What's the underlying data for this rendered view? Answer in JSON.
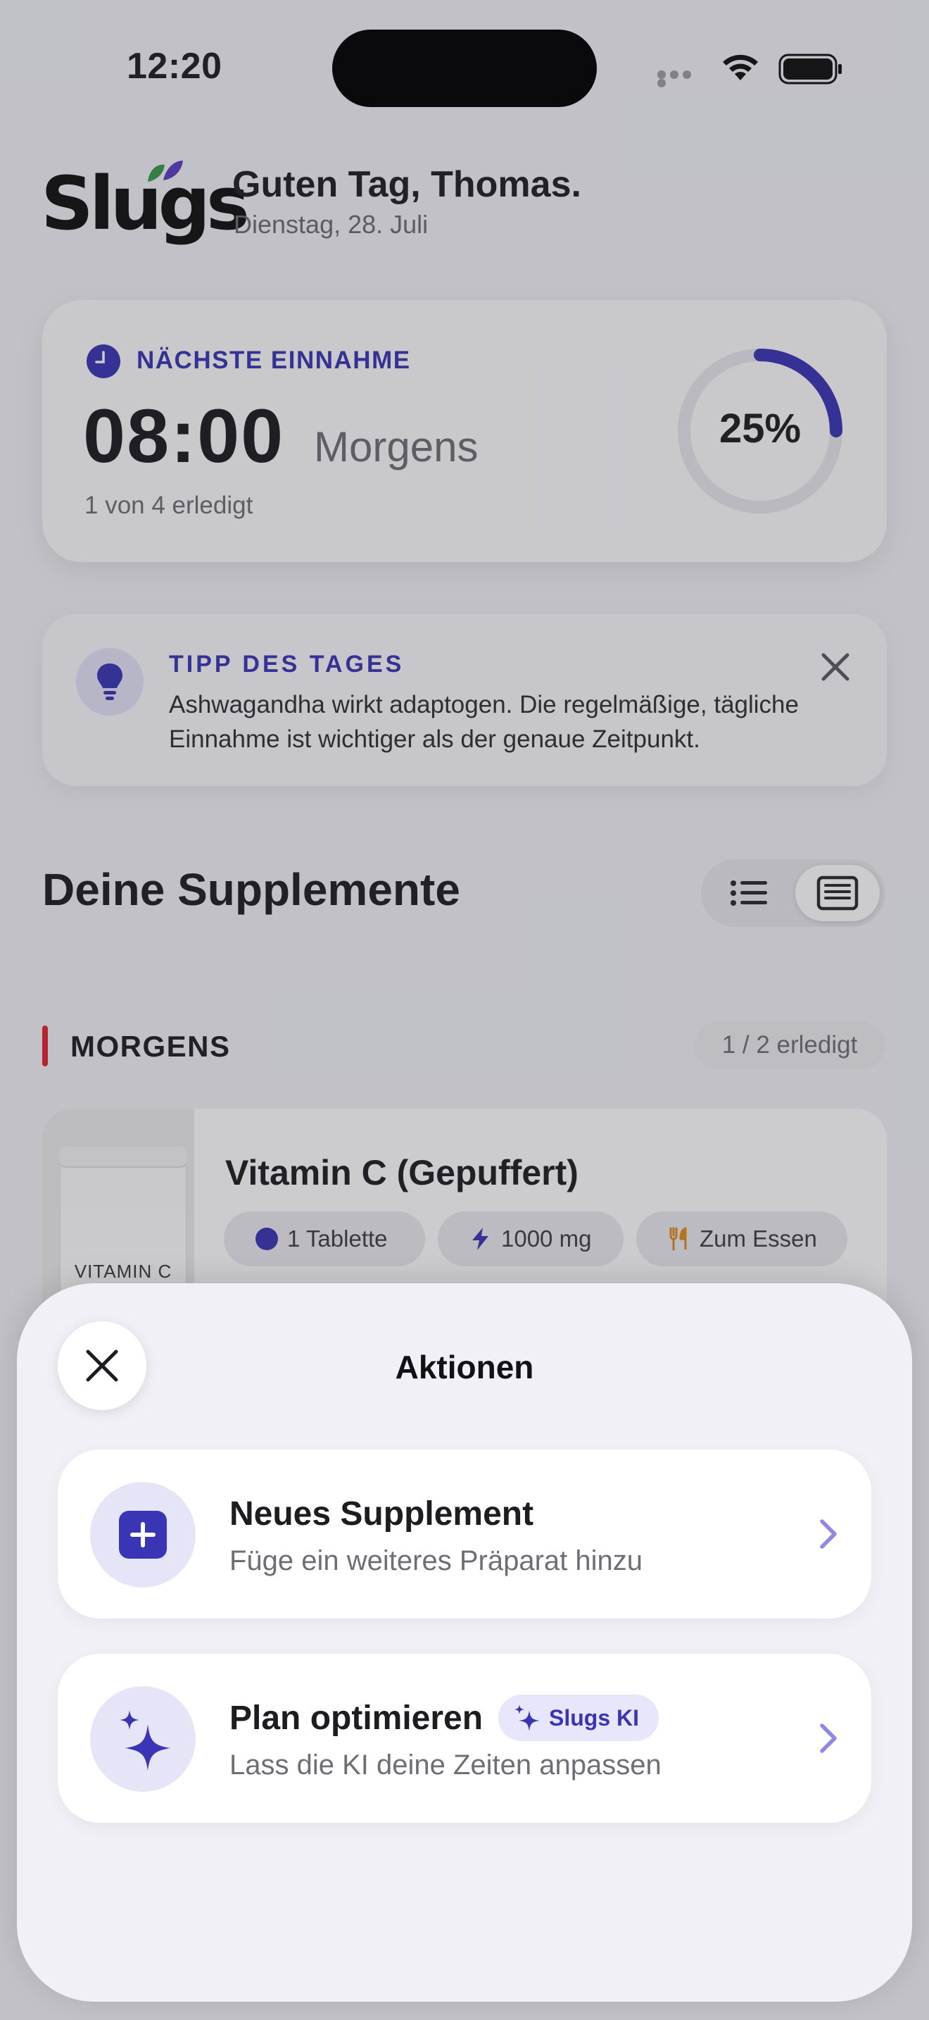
{
  "status": {
    "time": "12:20"
  },
  "header": {
    "logo": "Slugs",
    "greeting": "Guten Tag, Thomas.",
    "date": "Dienstag, 28. Juli"
  },
  "next_intake": {
    "label": "NÄCHSTE EINNAHME",
    "time": "08:00",
    "slot": "Morgens",
    "done_text": "1 von 4 erledigt",
    "progress_text": "25%",
    "progress": 0.25
  },
  "tip": {
    "title": "TIPP DES TAGES",
    "text": "Ashwagandha wirkt adaptogen. Die regelmäßige, tägliche Einnahme ist wichtiger als der genaue Zeitpunkt."
  },
  "supplements": {
    "title": "Deine Supplemente",
    "slot": {
      "title": "MORGENS",
      "count": "1 / 2 erledigt",
      "color": "#e0242c"
    },
    "item": {
      "name": "Vitamin C (Gepuffert)",
      "image_label": "VITAMIN C",
      "chips": [
        "1 Tablette",
        "1000 mg",
        "Zum Essen"
      ]
    }
  },
  "sheet": {
    "title": "Aktionen",
    "actions": [
      {
        "title": "Neues Supplement",
        "subtitle": "Füge ein weiteres Präparat hinzu",
        "icon": "plus-icon"
      },
      {
        "title": "Plan optimieren",
        "badge": "Slugs KI",
        "subtitle": "Lass die KI deine Zeiten anpassen",
        "icon": "sparkles-icon"
      }
    ]
  },
  "colors": {
    "accent": "#3a35b4",
    "accent_light": "#e6e5f8",
    "background": "#f1f1f6"
  }
}
